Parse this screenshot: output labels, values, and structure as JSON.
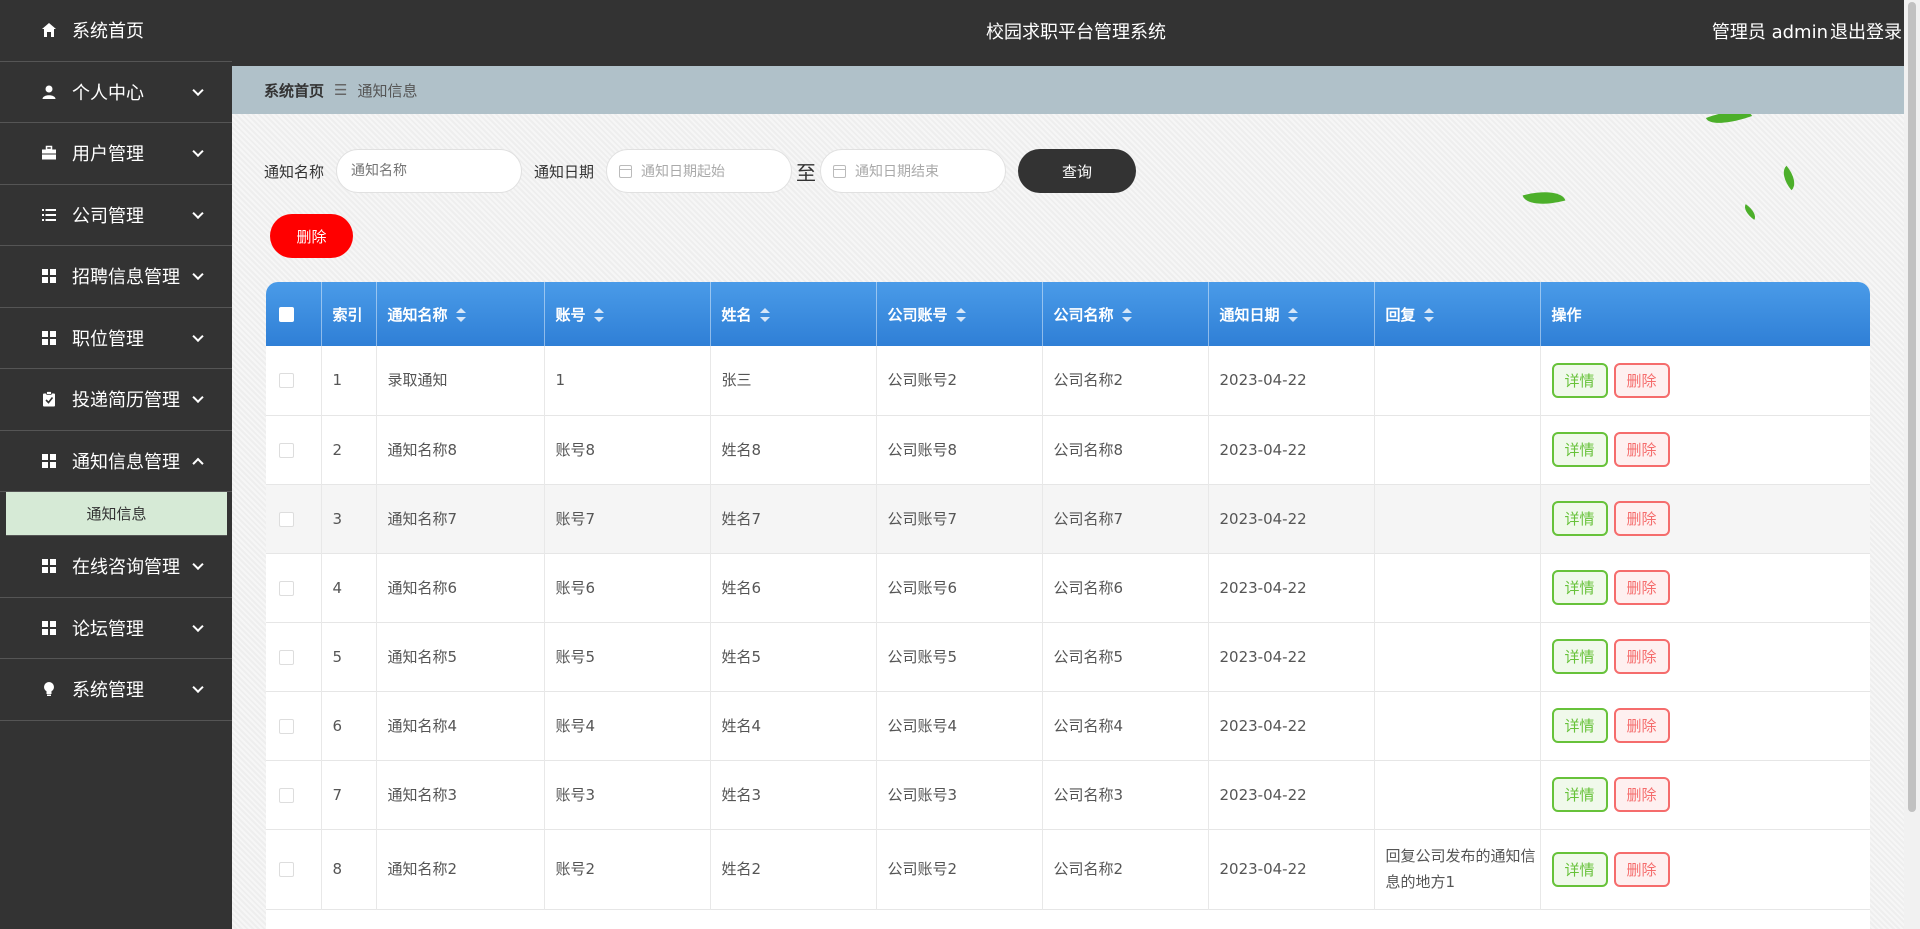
{
  "app": {
    "title": "校园求职平台管理系统",
    "user_label": "管理员 admin",
    "logout": "退出登录"
  },
  "sidebar": {
    "items": [
      {
        "label": "系统首页",
        "icon": "home-icon",
        "expandable": false
      },
      {
        "label": "个人中心",
        "icon": "user-icon",
        "expandable": true
      },
      {
        "label": "用户管理",
        "icon": "briefcase-icon",
        "expandable": true
      },
      {
        "label": "公司管理",
        "icon": "list-icon",
        "expandable": true
      },
      {
        "label": "招聘信息管理",
        "icon": "grid-icon",
        "expandable": true
      },
      {
        "label": "职位管理",
        "icon": "grid-icon",
        "expandable": true
      },
      {
        "label": "投递简历管理",
        "icon": "clipboard-icon",
        "expandable": true
      },
      {
        "label": "通知信息管理",
        "icon": "grid-icon",
        "expandable": true,
        "expanded": true
      },
      {
        "label": "在线咨询管理",
        "icon": "grid-icon",
        "expandable": true
      },
      {
        "label": "论坛管理",
        "icon": "grid-icon",
        "expandable": true
      },
      {
        "label": "系统管理",
        "icon": "bulb-icon",
        "expandable": true
      }
    ],
    "submenu": {
      "label": "通知信息"
    }
  },
  "breadcrumb": {
    "home": "系统首页",
    "separator": "☰",
    "current": "通知信息"
  },
  "search": {
    "name_label": "通知名称",
    "name_placeholder": "通知名称",
    "date_label": "通知日期",
    "date_start_placeholder": "通知日期起始",
    "to_label": "至",
    "date_end_placeholder": "通知日期结束",
    "query_button": "查询"
  },
  "actions": {
    "delete_button": "删除"
  },
  "table": {
    "headers": [
      "索引",
      "通知名称",
      "账号",
      "姓名",
      "公司账号",
      "公司名称",
      "通知日期",
      "回复",
      "操作"
    ],
    "detail_label": "详情",
    "delete_label": "删除",
    "rows": [
      {
        "index": "1",
        "name": "录取通知",
        "account": "1",
        "person": "张三",
        "company_account": "公司账号2",
        "company_name": "公司名称2",
        "date": "2023-04-22",
        "reply": ""
      },
      {
        "index": "2",
        "name": "通知名称8",
        "account": "账号8",
        "person": "姓名8",
        "company_account": "公司账号8",
        "company_name": "公司名称8",
        "date": "2023-04-22",
        "reply": ""
      },
      {
        "index": "3",
        "name": "通知名称7",
        "account": "账号7",
        "person": "姓名7",
        "company_account": "公司账号7",
        "company_name": "公司名称7",
        "date": "2023-04-22",
        "reply": ""
      },
      {
        "index": "4",
        "name": "通知名称6",
        "account": "账号6",
        "person": "姓名6",
        "company_account": "公司账号6",
        "company_name": "公司名称6",
        "date": "2023-04-22",
        "reply": ""
      },
      {
        "index": "5",
        "name": "通知名称5",
        "account": "账号5",
        "person": "姓名5",
        "company_account": "公司账号5",
        "company_name": "公司名称5",
        "date": "2023-04-22",
        "reply": ""
      },
      {
        "index": "6",
        "name": "通知名称4",
        "account": "账号4",
        "person": "姓名4",
        "company_account": "公司账号4",
        "company_name": "公司名称4",
        "date": "2023-04-22",
        "reply": ""
      },
      {
        "index": "7",
        "name": "通知名称3",
        "account": "账号3",
        "person": "姓名3",
        "company_account": "公司账号3",
        "company_name": "公司名称3",
        "date": "2023-04-22",
        "reply": ""
      },
      {
        "index": "8",
        "name": "通知名称2",
        "account": "账号2",
        "person": "姓名2",
        "company_account": "公司账号2",
        "company_name": "公司名称2",
        "date": "2023-04-22",
        "reply": "回复公司发布的通知信息的地方1"
      }
    ]
  },
  "colors": {
    "sidebar_bg": "#333333",
    "header_gradient_top": "#4a9be8",
    "header_gradient_bottom": "#2f7fd6",
    "delete_red": "#ff0000",
    "detail_green": "#67c23a",
    "submenu_bg": "#d6ead6"
  }
}
